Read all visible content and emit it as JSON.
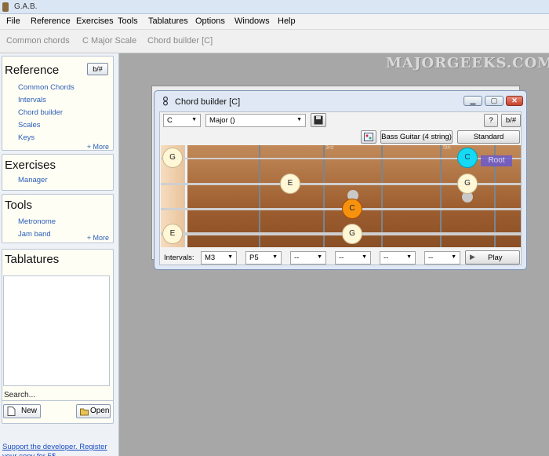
{
  "app": {
    "title": "G.A.B."
  },
  "menu": [
    "File",
    "Reference",
    "Exercises",
    "Tools",
    "Tablatures",
    "Options",
    "Windows",
    "Help"
  ],
  "tabs": [
    "Common chords",
    "C Major Scale",
    "Chord builder [C]"
  ],
  "sidebar": {
    "reference": {
      "title": "Reference",
      "toggle": "b/#",
      "items": [
        "Common Chords",
        "Intervals",
        "Chord builder",
        "Scales",
        "Keys"
      ],
      "more": "+ More"
    },
    "exercises": {
      "title": "Exercises",
      "items": [
        "Manager"
      ]
    },
    "tools": {
      "title": "Tools",
      "items": [
        "Metronome",
        "Jam band"
      ],
      "more": "+ More"
    },
    "tablatures": {
      "title": "Tablatures",
      "search_label": "Search...",
      "new_label": "New",
      "open_label": "Open"
    },
    "support": "Support the developer. Register your copy for 5$"
  },
  "watermark": "MAJORGEEKS.COM",
  "chord_builder": {
    "title": "Chord builder [C]",
    "min": "▁",
    "max": "▢",
    "close": "✕",
    "root_note": "C",
    "chord_type": "Major ()",
    "help": "?",
    "toggle": "b/#",
    "instrument": "Bass Guitar (4 string)",
    "tuning": "Standard",
    "fret_markers": {
      "third": "3rd",
      "fifth": "5th"
    },
    "root_label": "Root",
    "notes": [
      {
        "note": "G",
        "type": "normal"
      },
      {
        "note": "E",
        "type": "normal"
      },
      {
        "note": "E",
        "type": "normal"
      },
      {
        "note": "C",
        "type": "orange"
      },
      {
        "note": "G",
        "type": "normal"
      },
      {
        "note": "C",
        "type": "root"
      },
      {
        "note": "G",
        "type": "normal"
      }
    ],
    "intervals_label": "Intervals:",
    "intervals": [
      "M3",
      "P5",
      "--",
      "--",
      "--",
      "--"
    ],
    "play_label": "Play"
  },
  "colors": {
    "root": "#16d9f4",
    "highlight": "#f7920f",
    "link": "#2a5db8"
  }
}
